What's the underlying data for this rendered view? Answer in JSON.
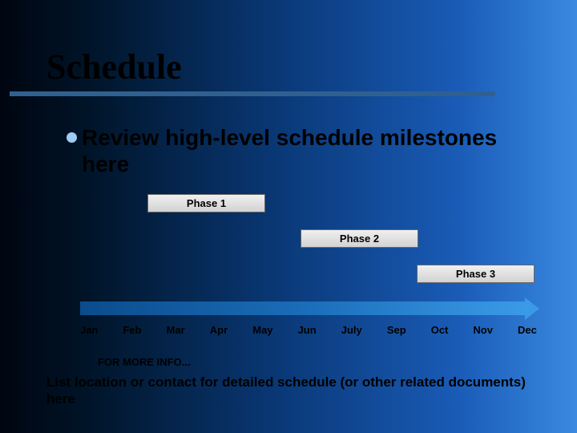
{
  "title": "Schedule",
  "bullet": "Review high-level schedule milestones here",
  "phases": {
    "p1": "Phase 1",
    "p2": "Phase 2",
    "p3": "Phase 3"
  },
  "months": [
    "Jan",
    "Feb",
    "Mar",
    "Apr",
    "May",
    "Jun",
    "July",
    "Sep",
    "Oct",
    "Nov",
    "Dec"
  ],
  "info_label": "FOR MORE INFO...",
  "info_text": "List location or contact for detailed schedule (or other related documents) here"
}
